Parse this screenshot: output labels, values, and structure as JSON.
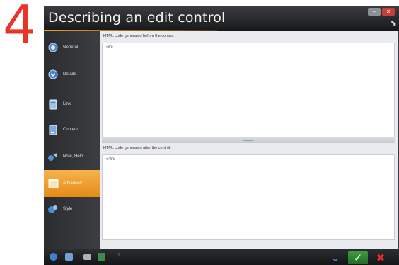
{
  "step_number": "4",
  "window": {
    "title": "Describing an edit control",
    "buttons": {
      "minimize": "–",
      "close": "✕"
    }
  },
  "sidebar": {
    "items": [
      {
        "label": "General",
        "icon": "globe-icon",
        "active": false
      },
      {
        "label": "Details",
        "icon": "details-arrow-icon",
        "active": false
      },
      {
        "label": "Link",
        "icon": "link-page-icon",
        "active": false
      },
      {
        "label": "Content",
        "icon": "content-page-icon",
        "active": false
      },
      {
        "label": "Note, Help",
        "icon": "help-note-icon",
        "active": false
      },
      {
        "label": "Advanced",
        "icon": "advanced-window-icon",
        "active": true
      },
      {
        "label": "Style",
        "icon": "style-icon",
        "active": false
      }
    ]
  },
  "panes": {
    "before_label": "HTML code generated before the control:",
    "before_code": "<BR>",
    "after_label": "HTML code generated after the control:",
    "after_code": "</BR>"
  },
  "bottombar": {
    "status_text": "?",
    "icons": [
      "help-icon",
      "save-icon",
      "print-icon",
      "export-icon"
    ]
  },
  "actions": {
    "down": "⌄",
    "ok": "✓",
    "cancel": "✖"
  },
  "colors": {
    "accent_orange": "#ee9a27",
    "step_red": "#e8352a",
    "ok_green": "#2f8a31",
    "cancel_red": "#e02b2b"
  }
}
